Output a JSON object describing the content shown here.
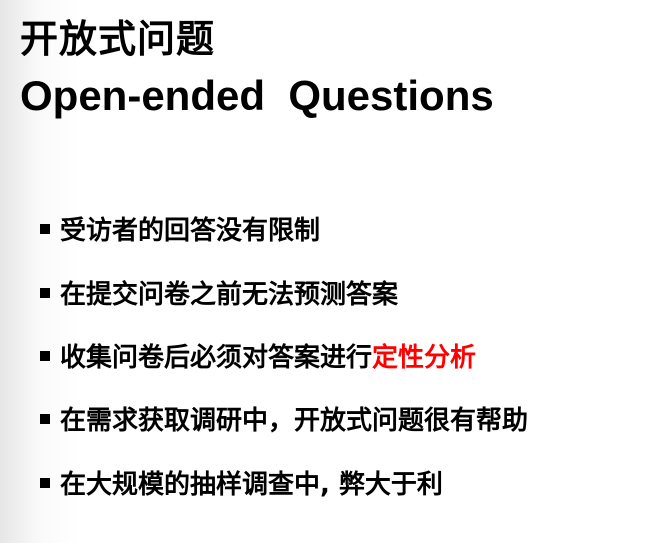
{
  "title_cn": "开放式问题",
  "title_en": "Open-ended  Questions",
  "bullets": [
    {
      "text": "受访者的回答没有限制"
    },
    {
      "text": "在提交问卷之前无法预测答案"
    },
    {
      "text": "收集问卷后必须对答案进行",
      "highlight": "定性分析"
    },
    {
      "text": "在需求获取调研中，开放式问题很有帮助"
    },
    {
      "text": "在大规模的抽样调查中, 弊大于利"
    }
  ],
  "highlight_color": "#ff0000"
}
